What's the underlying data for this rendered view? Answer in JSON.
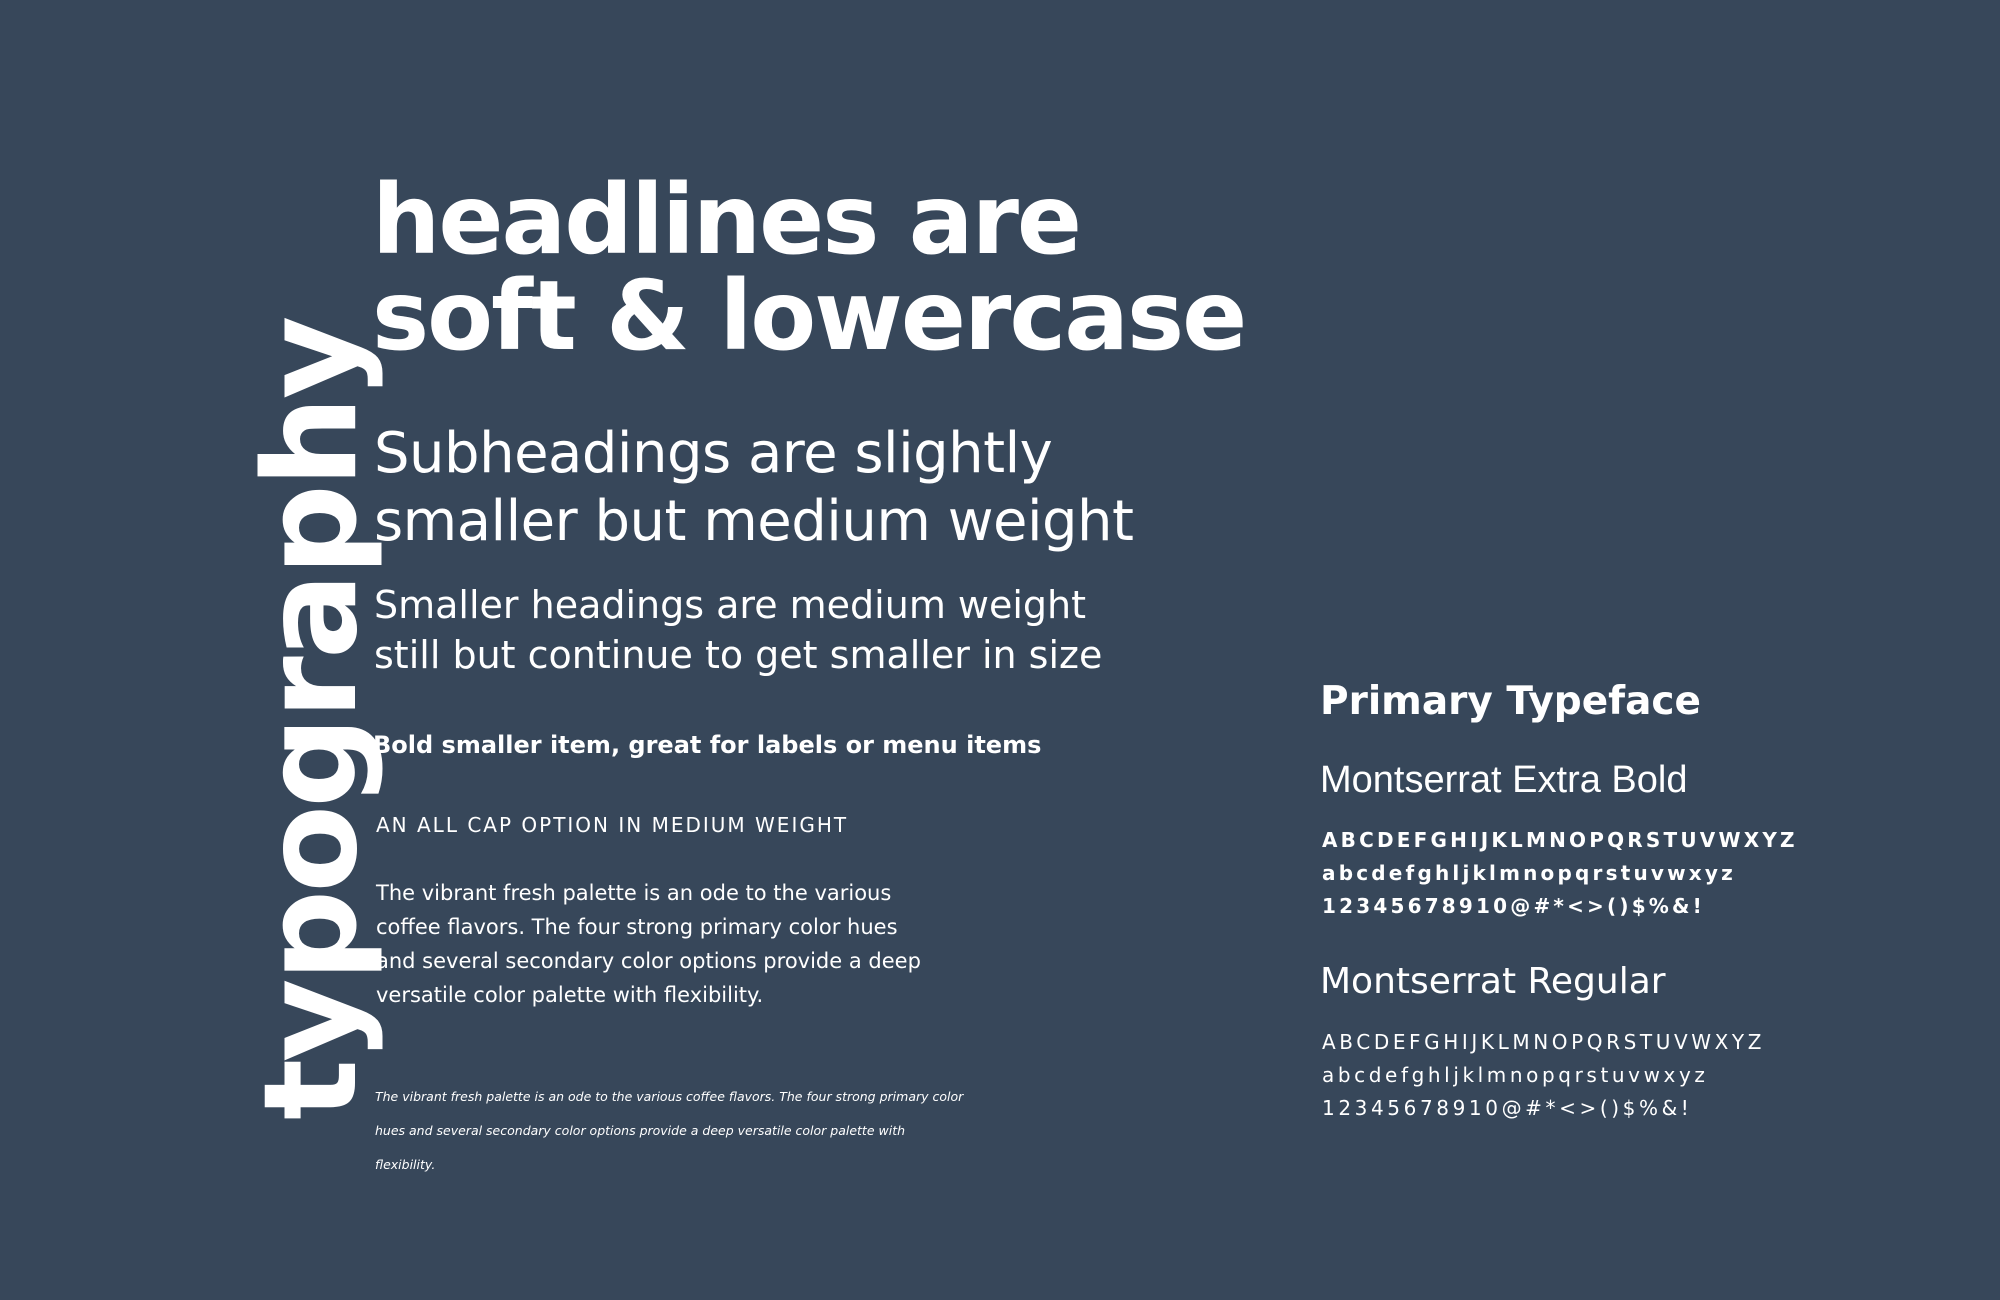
{
  "colors": {
    "background": "#37475a",
    "text": "#ffffff"
  },
  "vertical_title": "typography",
  "headline": {
    "line1": "headlines are",
    "line2": "soft & lowercase"
  },
  "subheading": {
    "line1": "Subheadings are slightly",
    "line2": "smaller but medium weight"
  },
  "smaller_heading": {
    "line1": "Smaller headings are medium weight",
    "line2": "still but continue to get smaller in size"
  },
  "bold_label": "Bold smaller item, great for labels or menu items",
  "allcap_label": "AN ALL CAP OPTION IN MEDIUM WEIGHT",
  "body_text": {
    "line1": "The vibrant fresh palette is an ode to the various",
    "line2": "coffee flavors. The four strong primary color hues",
    "line3": "and several secondary color options provide a deep",
    "line4": "versatile color palette with flexibility."
  },
  "small_italic_text": {
    "line1": "The vibrant fresh palette is an ode to the various coffee flavors. The four strong primary color",
    "line2": "hues and several secondary color options provide a deep versatile color palette with",
    "line3": "flexibility."
  },
  "primary_typeface": {
    "title": "Primary Typeface",
    "extra_bold": {
      "name": "Montserrat Extra Bold",
      "uppercase": "ABCDEFGHIJKLMNOPQRSTUVWXYZ",
      "lowercase": "abcdefghljklmnopqrstuvwxyz",
      "symbols": "12345678910@#*<>()$%&!"
    },
    "regular": {
      "name": "Montserrat Regular",
      "uppercase": "ABCDEFGHIJKLMNOPQRSTUVWXYZ",
      "lowercase": "abcdefghljklmnopqrstuvwxyz",
      "symbols": "12345678910@#*<>()$%&!"
    }
  }
}
